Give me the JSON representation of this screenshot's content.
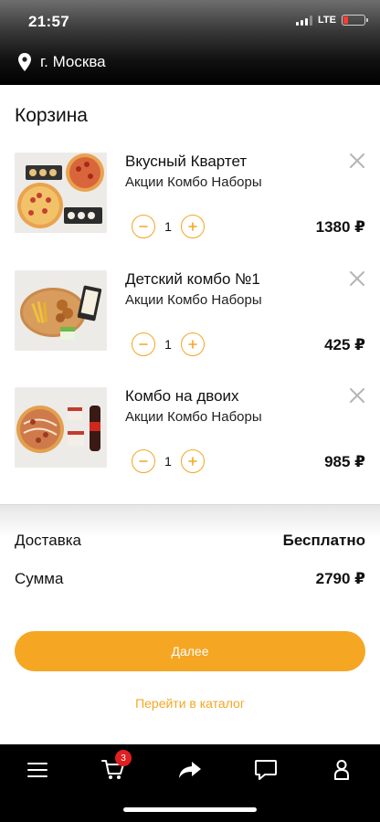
{
  "status_bar": {
    "time": "21:57",
    "network": "LTE",
    "battery_color": "#ff3b30"
  },
  "location": {
    "icon": "location-pin-icon",
    "city": "г. Москва"
  },
  "cart": {
    "title": "Корзина",
    "items": [
      {
        "name": "Вкусный Квартет",
        "category": "Акции Комбо Наборы",
        "quantity": "1",
        "price": "1380 ₽"
      },
      {
        "name": "Детский комбо №1",
        "category": "Акции Комбо Наборы",
        "quantity": "1",
        "price": "425 ₽"
      },
      {
        "name": "Комбо на двоих",
        "category": "Акции Комбо Наборы",
        "quantity": "1",
        "price": "985 ₽"
      }
    ]
  },
  "summary": {
    "delivery_label": "Доставка",
    "delivery_value": "Бесплатно",
    "total_label": "Сумма",
    "total_value": "2790 ₽"
  },
  "actions": {
    "next_label": "Далее",
    "catalog_link": "Перейти в каталог"
  },
  "tabbar": {
    "cart_badge": "3",
    "icons": [
      "menu-icon",
      "cart-icon",
      "share-icon",
      "chat-icon",
      "profile-icon"
    ]
  },
  "colors": {
    "accent": "#f5a623",
    "badge": "#e02020"
  }
}
